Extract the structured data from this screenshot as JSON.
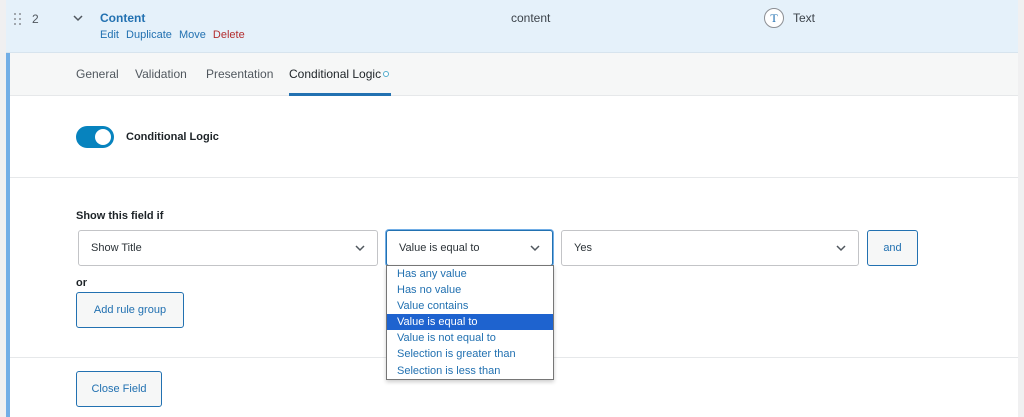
{
  "field": {
    "order": "2",
    "label": "Content",
    "actions": {
      "edit": "Edit",
      "duplicate": "Duplicate",
      "move": "Move",
      "delete": "Delete"
    },
    "name": "content",
    "type_icon_letter": "T",
    "type": "Text"
  },
  "tabs": [
    {
      "label": "General"
    },
    {
      "label": "Validation"
    },
    {
      "label": "Presentation"
    },
    {
      "label": "Conditional Logic",
      "active": true
    }
  ],
  "conditional_logic": {
    "toggle_label": "Conditional Logic",
    "toggle_on": true,
    "rules_title": "Show this field if",
    "rule": {
      "field_value": "Show Title",
      "operator_value": "Value is equal to",
      "compare_value": "Yes"
    },
    "and_label": "and",
    "or_label": "or",
    "add_group_label": "Add rule group"
  },
  "operator_options": [
    "Has any value",
    "Has no value",
    "Value contains",
    "Value is equal to",
    "Value is not equal to",
    "Selection is greater than",
    "Selection is less than"
  ],
  "operator_selected_index": 3,
  "close_field_label": "Close Field",
  "colors": {
    "accent": "#2271b1",
    "toggle_on": "#0783be",
    "delete": "#b32d2e",
    "row_highlight": "#e5f1fa",
    "option_selected": "#1e63cf"
  }
}
